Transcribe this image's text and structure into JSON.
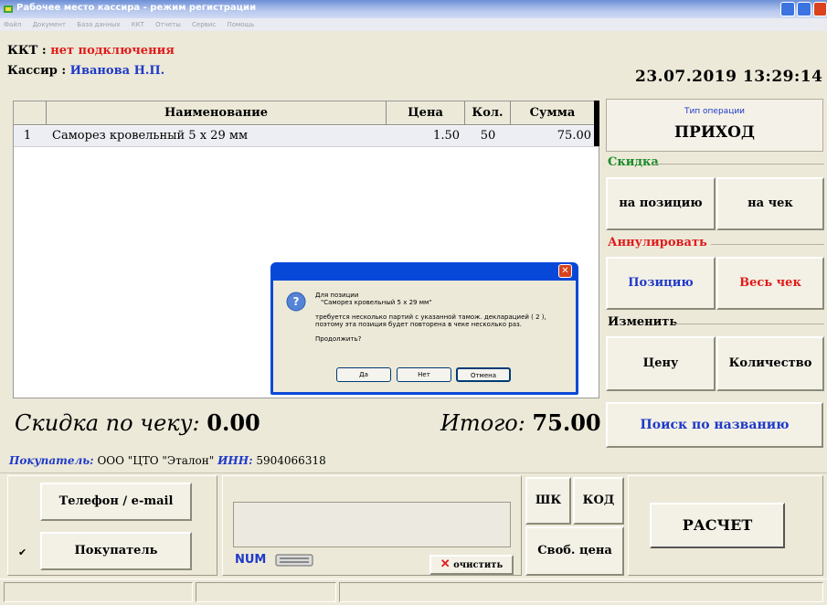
{
  "window": {
    "title": "Рабочее место кассира - режим регистрации"
  },
  "menu": [
    "Файл",
    "Документ",
    "База данных",
    "ККТ",
    "Отчеты",
    "Сервис",
    "Помощь"
  ],
  "header": {
    "kkt_label": "ККТ :",
    "kkt_status": "нет подключения",
    "cashier_label": "Кассир :",
    "cashier_name": "Иванова Н.П.",
    "datetime": "23.07.2019  13:29:14"
  },
  "table": {
    "columns": [
      "Наименование",
      "Цена",
      "Кол.",
      "Сумма"
    ],
    "rows": [
      {
        "num": "1",
        "name": "Саморез кровельный 5 х 29 мм",
        "price": "1.50",
        "qty": "50",
        "sum": "75.00"
      }
    ]
  },
  "operation": {
    "label": "Тип операции",
    "value": "ПРИХОД"
  },
  "discount_group": {
    "title": "Скидка",
    "item_button": "на позицию",
    "check_button": "на чек"
  },
  "cancel_group": {
    "title": "Аннулировать",
    "item_button": "Позицию",
    "check_button": "Весь чек"
  },
  "change_group": {
    "title": "Изменить",
    "price_button": "Цену",
    "qty_button": "Количество"
  },
  "totals": {
    "discount_label": "Скидка по чеку:",
    "discount_value": "0.00",
    "total_label": "Итого:",
    "total_value": "75.00"
  },
  "search_button": "Поиск по названию",
  "buyer": {
    "buyer_label": "Покупатель:",
    "buyer_name": "ООО \"ЦТО \"Эталон\"",
    "inn_label": "ИНН:",
    "inn_value": "5904066318"
  },
  "bottom": {
    "phone_button": "Телефон / e-mail",
    "buyer_button": "Покупатель",
    "num_indicator": "NUM",
    "clear_button": "очистить",
    "barcode_button": "ШК",
    "code_button": "КОД",
    "free_price_button": "Своб. цена",
    "pay_button": "РАСЧЕТ"
  },
  "dialog": {
    "line1": "Для позиции",
    "line2": "\"Саморез кровельный 5 х 29 мм\"",
    "line3": "требуется несколько партий с указанной тамож. декларацией ( 2 ),",
    "line4": "поэтому эта позиция будет повторена в чеке несколько раз.",
    "line5": "Продолжить?",
    "yes": "Да",
    "no": "Нет",
    "cancel": "Отмена"
  },
  "colors": {
    "red": "#e11b1b",
    "blue": "#1f39c8",
    "dialog_blue": "#0848d8"
  }
}
